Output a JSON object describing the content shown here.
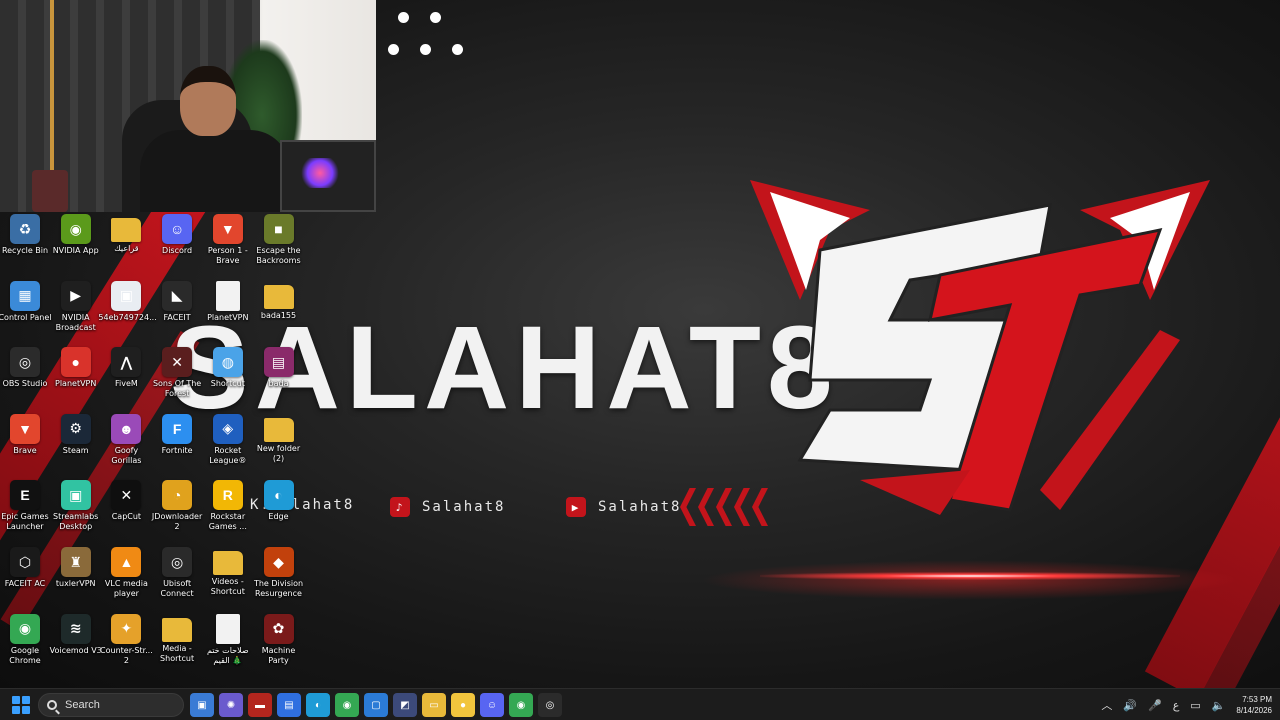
{
  "wallpaper": {
    "brand_text": "SALAHAT8",
    "social_1": "Salahat8",
    "social_2": "Salahat8",
    "social_3": "K.Salahat8",
    "accent_color": "#c3141b"
  },
  "desktop_icons": [
    {
      "label": "Recycle Bin",
      "icon": "recycle-bin-icon",
      "color": "#3a6ea5",
      "glyph": "♻",
      "col": 0,
      "row": 0
    },
    {
      "label": "NVIDIA App",
      "icon": "nvidia-icon",
      "color": "#5b9a1b",
      "glyph": "◉",
      "col": 1,
      "row": 0
    },
    {
      "label": "قراعيك",
      "icon": "folder-icon",
      "color": "#e8b93a",
      "glyph": "",
      "col": 2,
      "row": 0
    },
    {
      "label": "Discord",
      "icon": "discord-icon",
      "color": "#5865f2",
      "glyph": "☺",
      "col": 3,
      "row": 0
    },
    {
      "label": "Person 1 - Brave",
      "icon": "brave-icon",
      "color": "#e2462d",
      "glyph": "▼",
      "col": 4,
      "row": 0
    },
    {
      "label": "Escape the Backrooms",
      "icon": "game-icon",
      "color": "#6a7a2a",
      "glyph": "■",
      "col": 5,
      "row": 0
    },
    {
      "label": "Control Panel",
      "icon": "control-panel-icon",
      "color": "#3b8ad8",
      "glyph": "▦",
      "col": 0,
      "row": 1
    },
    {
      "label": "NVIDIA Broadcast",
      "icon": "nvidia-broadcast-icon",
      "color": "#1f1f1f",
      "glyph": "▶",
      "col": 1,
      "row": 1
    },
    {
      "label": "54eb749724...",
      "icon": "file-icon",
      "color": "#e9edf2",
      "glyph": "▣",
      "col": 2,
      "row": 1
    },
    {
      "label": "FACEIT",
      "icon": "faceit-icon",
      "color": "#2a2a2a",
      "glyph": "◣",
      "col": 3,
      "row": 1
    },
    {
      "label": "PlanetVPN",
      "icon": "document-icon",
      "color": "#f2f2f2",
      "glyph": "",
      "col": 4,
      "row": 1
    },
    {
      "label": "bada155",
      "icon": "folder-icon",
      "color": "#e8b93a",
      "glyph": "",
      "col": 5,
      "row": 1
    },
    {
      "label": "OBS Studio",
      "icon": "obs-icon",
      "color": "#2b2b2b",
      "glyph": "◎",
      "col": 0,
      "row": 2
    },
    {
      "label": "PlanetVPN",
      "icon": "planetvpn-icon",
      "color": "#d9332b",
      "glyph": "●",
      "col": 1,
      "row": 2
    },
    {
      "label": "FiveM",
      "icon": "fivem-icon",
      "color": "#1f1f1f",
      "glyph": "⋀",
      "col": 2,
      "row": 2
    },
    {
      "label": "Sons Of The Forest",
      "icon": "game-icon",
      "color": "#5a1e1e",
      "glyph": "✕",
      "col": 3,
      "row": 2
    },
    {
      "label": "Shortcut",
      "icon": "shortcut-icon",
      "color": "#4aa3e8",
      "glyph": "◍",
      "col": 4,
      "row": 2
    },
    {
      "label": "bada",
      "icon": "winrar-icon",
      "color": "#8a2a6a",
      "glyph": "▤",
      "col": 5,
      "row": 2
    },
    {
      "label": "Brave",
      "icon": "brave-icon",
      "color": "#e2462d",
      "glyph": "▼",
      "col": 0,
      "row": 3
    },
    {
      "label": "Steam",
      "icon": "steam-icon",
      "color": "#1b2838",
      "glyph": "⚙",
      "col": 1,
      "row": 3
    },
    {
      "label": "Goofy Gorillas",
      "icon": "game-icon",
      "color": "#9a4ab8",
      "glyph": "☻",
      "col": 2,
      "row": 3
    },
    {
      "label": "Fortnite",
      "icon": "fortnite-icon",
      "color": "#2c8ff0",
      "glyph": "F",
      "col": 3,
      "row": 3
    },
    {
      "label": "Rocket League®",
      "icon": "rocket-league-icon",
      "color": "#1f5fbf",
      "glyph": "◈",
      "col": 4,
      "row": 3
    },
    {
      "label": "New folder (2)",
      "icon": "folder-icon",
      "color": "#e8b93a",
      "glyph": "",
      "col": 5,
      "row": 3
    },
    {
      "label": "Epic Games Launcher",
      "icon": "epic-games-icon",
      "color": "#111111",
      "glyph": "E",
      "col": 0,
      "row": 4
    },
    {
      "label": "Streamlabs Desktop",
      "icon": "streamlabs-icon",
      "color": "#31c3a2",
      "glyph": "▣",
      "col": 1,
      "row": 4
    },
    {
      "label": "CapCut",
      "icon": "capcut-icon",
      "color": "#0f0f0f",
      "glyph": "✕",
      "col": 2,
      "row": 4
    },
    {
      "label": "JDownloader 2",
      "icon": "jdownloader-icon",
      "color": "#e0a21d",
      "glyph": "◔",
      "col": 3,
      "row": 4
    },
    {
      "label": "Rockstar Games ...",
      "icon": "rockstar-icon",
      "color": "#f2b705",
      "glyph": "R",
      "col": 4,
      "row": 4
    },
    {
      "label": "Edge",
      "icon": "edge-icon",
      "color": "#1f9bd6",
      "glyph": "◐",
      "col": 5,
      "row": 4
    },
    {
      "label": "FACEIT AC",
      "icon": "faceit-ac-icon",
      "color": "#1a1a1a",
      "glyph": "⬡",
      "col": 0,
      "row": 5
    },
    {
      "label": "tuxlerVPN",
      "icon": "tuxlervpn-icon",
      "color": "#8a6a3a",
      "glyph": "♜",
      "col": 1,
      "row": 5
    },
    {
      "label": "VLC media player",
      "icon": "vlc-icon",
      "color": "#f08a14",
      "glyph": "▲",
      "col": 2,
      "row": 5
    },
    {
      "label": "Ubisoft Connect",
      "icon": "ubisoft-icon",
      "color": "#2a2a2a",
      "glyph": "◎",
      "col": 3,
      "row": 5
    },
    {
      "label": "Videos - Shortcut",
      "icon": "folder-icon",
      "color": "#e8b93a",
      "glyph": "",
      "col": 4,
      "row": 5
    },
    {
      "label": "The Division Resurgence",
      "icon": "game-icon",
      "color": "#c2410c",
      "glyph": "◆",
      "col": 5,
      "row": 5
    },
    {
      "label": "Google Chrome",
      "icon": "chrome-icon",
      "color": "#34a853",
      "glyph": "◉",
      "col": 0,
      "row": 6
    },
    {
      "label": "Voicemod V3",
      "icon": "voicemod-icon",
      "color": "#1e2a2a",
      "glyph": "≋",
      "col": 1,
      "row": 6
    },
    {
      "label": "Counter-Str... 2",
      "icon": "cs2-icon",
      "color": "#e5a12a",
      "glyph": "✦",
      "col": 2,
      "row": 6
    },
    {
      "label": "Media - Shortcut",
      "icon": "folder-icon",
      "color": "#e8b93a",
      "glyph": "",
      "col": 3,
      "row": 6
    },
    {
      "label": "صلاحات ختم القيم 🎄",
      "icon": "document-icon",
      "color": "#f2f2f2",
      "glyph": "",
      "col": 4,
      "row": 6
    },
    {
      "label": "Machine Party",
      "icon": "game-icon",
      "color": "#7a1a1a",
      "glyph": "✿",
      "col": 5,
      "row": 6
    }
  ],
  "taskbar": {
    "search_label": "Search",
    "apps": [
      {
        "icon": "widgets-icon",
        "color": "#3a7bd5",
        "glyph": "▣"
      },
      {
        "icon": "copilot-icon",
        "color": "#6a5acd",
        "glyph": "✺"
      },
      {
        "icon": "voicemod-taskbar-icon",
        "color": "#b3261e",
        "glyph": "▬"
      },
      {
        "icon": "store-icon",
        "color": "#2f6fe0",
        "glyph": "▤"
      },
      {
        "icon": "edge-taskbar-icon",
        "color": "#1f9bd6",
        "glyph": "◐"
      },
      {
        "icon": "chrome-taskbar-icon",
        "color": "#34a853",
        "glyph": "◉"
      },
      {
        "icon": "window-icon",
        "color": "#2b7bd6",
        "glyph": "▢"
      },
      {
        "icon": "app-icon",
        "color": "#3c4a7a",
        "glyph": "◩"
      },
      {
        "icon": "file-explorer-icon",
        "color": "#e8b93a",
        "glyph": "▭"
      },
      {
        "icon": "yellow-app-icon",
        "color": "#f2c53d",
        "glyph": "●"
      },
      {
        "icon": "discord-taskbar-icon",
        "color": "#5865f2",
        "glyph": "☺"
      },
      {
        "icon": "chrome-taskbar-icon-2",
        "color": "#34a853",
        "glyph": "◉"
      },
      {
        "icon": "obs-taskbar-icon",
        "color": "#2b2b2b",
        "glyph": "◎"
      }
    ],
    "tray_lang": "ع",
    "time": "7:53 PM",
    "date": "8/14/2026"
  }
}
